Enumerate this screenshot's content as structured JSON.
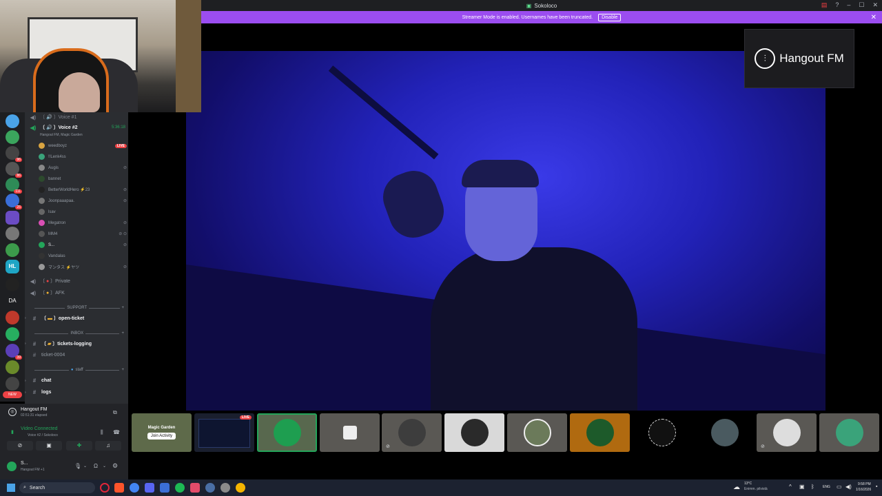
{
  "window": {
    "title": "Sokoloco"
  },
  "streamer_banner": {
    "message": "Streamer Mode is enabled. Usernames have been truncated.",
    "button": "Disable"
  },
  "rail": {
    "badges": [
      "96",
      "86",
      "111",
      "25",
      "39",
      "NEW"
    ],
    "text_icons": [
      "HL",
      "DA"
    ]
  },
  "channels": {
    "voice1": "Voice #1",
    "voice2": {
      "name": "Voice #2",
      "timer": "5:36:18",
      "activity": "Hangout FM, Magic Garden"
    },
    "members": [
      {
        "name": "weedboyz",
        "live": "LIVE"
      },
      {
        "name": "!!Lenk4ss"
      },
      {
        "name": "Augis"
      },
      {
        "name": "bannet"
      },
      {
        "name": "BetterWorldHero ⚡23"
      },
      {
        "name": "Joonpaaapaa."
      },
      {
        "name": "lsav"
      },
      {
        "name": "Megatron"
      },
      {
        "name": "MM4"
      },
      {
        "name": "S..."
      },
      {
        "name": "Vandalas"
      },
      {
        "name": "マンタス ⚡ヤツ"
      }
    ],
    "private": "Private",
    "afk": "AFK",
    "support_category": "SUPPORT",
    "open_ticket": "open-ticket",
    "inbox_category": "INBOX",
    "tickets_logging": "tickets-logging",
    "ticket_0004": "ticket-0004",
    "staff_category": "staff",
    "chat": "chat",
    "logs": "logs"
  },
  "voice_panel": {
    "activity_name": "Hangout FM",
    "elapsed": "02:51:31 elapsed",
    "status": "Video Connected",
    "location": "Voice #2 / Sokoloco",
    "user_name": "S...",
    "user_status": "Hangout FM +1"
  },
  "overlay": {
    "logo_text": "Hangout FM"
  },
  "tiles": {
    "magic_garden": "Magic Garden",
    "join_activity": "Join Activity",
    "live": "LIVE"
  },
  "taskbar": {
    "search_placeholder": "Search",
    "weather_temp": "13°C",
    "weather_desc": "Enimm. pilvistä",
    "lang": "ENG",
    "time": "9:58 PM",
    "date": "1/16/2026"
  },
  "colors": {
    "accent": "#9b4df0",
    "live": "#ed4245",
    "connected": "#23a55a"
  }
}
